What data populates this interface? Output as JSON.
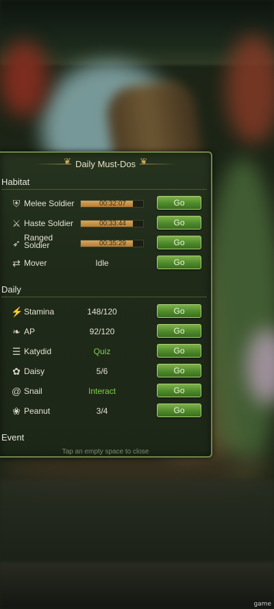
{
  "dialog": {
    "title": "Daily Must-Dos",
    "close_hint": "Tap an empty space to close"
  },
  "sections": {
    "habitat": "Habitat",
    "daily": "Daily",
    "event": "Event"
  },
  "habitat_rows": [
    {
      "name": "Melee Soldier",
      "icon": "shield-icon",
      "timer": "00:32:07",
      "progress": 0.83,
      "button": "Go"
    },
    {
      "name": "Haste Soldier",
      "icon": "running-soldier-icon",
      "timer": "00:33:44",
      "progress": 0.83,
      "button": "Go"
    },
    {
      "name": "Ranged",
      "name2": "Soldier",
      "icon": "ranged-soldier-icon",
      "timer": "00:35:29",
      "progress": 0.83,
      "button": "Go"
    },
    {
      "name": "Mover",
      "icon": "mover-icon",
      "status": "Idle",
      "button": "Go"
    }
  ],
  "daily_rows": [
    {
      "name": "Stamina",
      "icon": "lightning-icon",
      "value": "148/120",
      "button": "Go"
    },
    {
      "name": "AP",
      "icon": "leaf-icon",
      "value": "92/120",
      "button": "Go"
    },
    {
      "name": "Katydid",
      "icon": "book-icon",
      "value": "Quiz",
      "button": "Go"
    },
    {
      "name": "Daisy",
      "icon": "flower-icon",
      "value": "5/6",
      "button": "Go"
    },
    {
      "name": "Snail",
      "icon": "snail-icon",
      "value": "Interact",
      "button": "Go"
    },
    {
      "name": "Peanut",
      "icon": "peanut-icon",
      "value": "3/4",
      "button": "Go"
    }
  ],
  "watermark": "game",
  "colors": {
    "accent_green": "#7fd24a",
    "button_green": "#4e8a2b",
    "progress_orange": "#c88f45",
    "panel_border": "#6f8a48"
  }
}
